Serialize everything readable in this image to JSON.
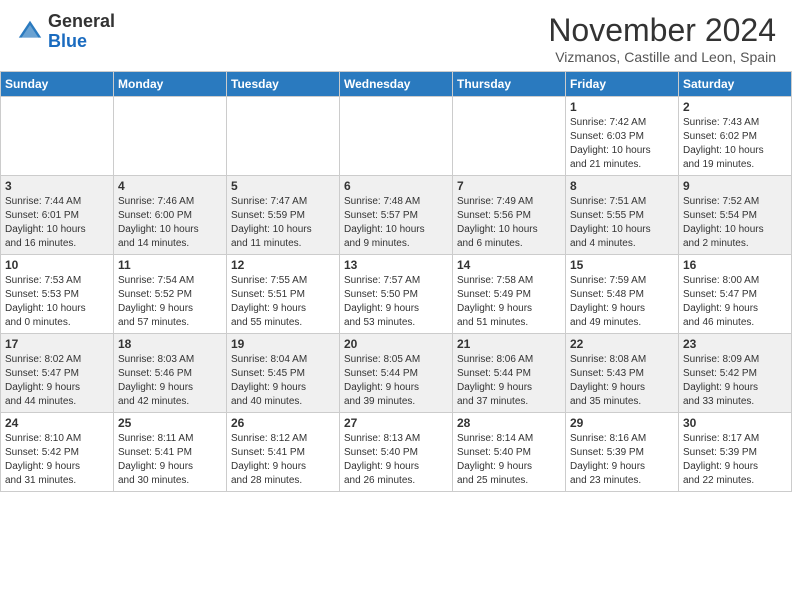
{
  "header": {
    "logo_line1": "General",
    "logo_line2": "Blue",
    "month": "November 2024",
    "location": "Vizmanos, Castille and Leon, Spain"
  },
  "days_of_week": [
    "Sunday",
    "Monday",
    "Tuesday",
    "Wednesday",
    "Thursday",
    "Friday",
    "Saturday"
  ],
  "weeks": [
    [
      {
        "day": "",
        "info": ""
      },
      {
        "day": "",
        "info": ""
      },
      {
        "day": "",
        "info": ""
      },
      {
        "day": "",
        "info": ""
      },
      {
        "day": "",
        "info": ""
      },
      {
        "day": "1",
        "info": "Sunrise: 7:42 AM\nSunset: 6:03 PM\nDaylight: 10 hours\nand 21 minutes."
      },
      {
        "day": "2",
        "info": "Sunrise: 7:43 AM\nSunset: 6:02 PM\nDaylight: 10 hours\nand 19 minutes."
      }
    ],
    [
      {
        "day": "3",
        "info": "Sunrise: 7:44 AM\nSunset: 6:01 PM\nDaylight: 10 hours\nand 16 minutes."
      },
      {
        "day": "4",
        "info": "Sunrise: 7:46 AM\nSunset: 6:00 PM\nDaylight: 10 hours\nand 14 minutes."
      },
      {
        "day": "5",
        "info": "Sunrise: 7:47 AM\nSunset: 5:59 PM\nDaylight: 10 hours\nand 11 minutes."
      },
      {
        "day": "6",
        "info": "Sunrise: 7:48 AM\nSunset: 5:57 PM\nDaylight: 10 hours\nand 9 minutes."
      },
      {
        "day": "7",
        "info": "Sunrise: 7:49 AM\nSunset: 5:56 PM\nDaylight: 10 hours\nand 6 minutes."
      },
      {
        "day": "8",
        "info": "Sunrise: 7:51 AM\nSunset: 5:55 PM\nDaylight: 10 hours\nand 4 minutes."
      },
      {
        "day": "9",
        "info": "Sunrise: 7:52 AM\nSunset: 5:54 PM\nDaylight: 10 hours\nand 2 minutes."
      }
    ],
    [
      {
        "day": "10",
        "info": "Sunrise: 7:53 AM\nSunset: 5:53 PM\nDaylight: 10 hours\nand 0 minutes."
      },
      {
        "day": "11",
        "info": "Sunrise: 7:54 AM\nSunset: 5:52 PM\nDaylight: 9 hours\nand 57 minutes."
      },
      {
        "day": "12",
        "info": "Sunrise: 7:55 AM\nSunset: 5:51 PM\nDaylight: 9 hours\nand 55 minutes."
      },
      {
        "day": "13",
        "info": "Sunrise: 7:57 AM\nSunset: 5:50 PM\nDaylight: 9 hours\nand 53 minutes."
      },
      {
        "day": "14",
        "info": "Sunrise: 7:58 AM\nSunset: 5:49 PM\nDaylight: 9 hours\nand 51 minutes."
      },
      {
        "day": "15",
        "info": "Sunrise: 7:59 AM\nSunset: 5:48 PM\nDaylight: 9 hours\nand 49 minutes."
      },
      {
        "day": "16",
        "info": "Sunrise: 8:00 AM\nSunset: 5:47 PM\nDaylight: 9 hours\nand 46 minutes."
      }
    ],
    [
      {
        "day": "17",
        "info": "Sunrise: 8:02 AM\nSunset: 5:47 PM\nDaylight: 9 hours\nand 44 minutes."
      },
      {
        "day": "18",
        "info": "Sunrise: 8:03 AM\nSunset: 5:46 PM\nDaylight: 9 hours\nand 42 minutes."
      },
      {
        "day": "19",
        "info": "Sunrise: 8:04 AM\nSunset: 5:45 PM\nDaylight: 9 hours\nand 40 minutes."
      },
      {
        "day": "20",
        "info": "Sunrise: 8:05 AM\nSunset: 5:44 PM\nDaylight: 9 hours\nand 39 minutes."
      },
      {
        "day": "21",
        "info": "Sunrise: 8:06 AM\nSunset: 5:44 PM\nDaylight: 9 hours\nand 37 minutes."
      },
      {
        "day": "22",
        "info": "Sunrise: 8:08 AM\nSunset: 5:43 PM\nDaylight: 9 hours\nand 35 minutes."
      },
      {
        "day": "23",
        "info": "Sunrise: 8:09 AM\nSunset: 5:42 PM\nDaylight: 9 hours\nand 33 minutes."
      }
    ],
    [
      {
        "day": "24",
        "info": "Sunrise: 8:10 AM\nSunset: 5:42 PM\nDaylight: 9 hours\nand 31 minutes."
      },
      {
        "day": "25",
        "info": "Sunrise: 8:11 AM\nSunset: 5:41 PM\nDaylight: 9 hours\nand 30 minutes."
      },
      {
        "day": "26",
        "info": "Sunrise: 8:12 AM\nSunset: 5:41 PM\nDaylight: 9 hours\nand 28 minutes."
      },
      {
        "day": "27",
        "info": "Sunrise: 8:13 AM\nSunset: 5:40 PM\nDaylight: 9 hours\nand 26 minutes."
      },
      {
        "day": "28",
        "info": "Sunrise: 8:14 AM\nSunset: 5:40 PM\nDaylight: 9 hours\nand 25 minutes."
      },
      {
        "day": "29",
        "info": "Sunrise: 8:16 AM\nSunset: 5:39 PM\nDaylight: 9 hours\nand 23 minutes."
      },
      {
        "day": "30",
        "info": "Sunrise: 8:17 AM\nSunset: 5:39 PM\nDaylight: 9 hours\nand 22 minutes."
      }
    ]
  ]
}
